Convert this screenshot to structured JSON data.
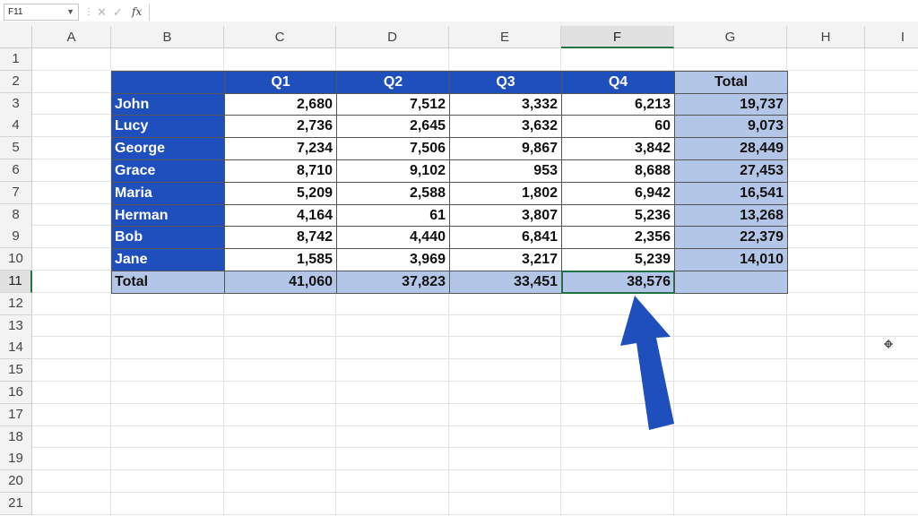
{
  "formula_bar": {
    "name_box": "F11",
    "cancel_icon": "close-icon",
    "enter_icon": "check-icon",
    "function_label": "fx",
    "formula": ""
  },
  "columns": [
    "A",
    "B",
    "C",
    "D",
    "E",
    "F",
    "G",
    "H",
    "I"
  ],
  "rows": [
    "1",
    "2",
    "3",
    "4",
    "5",
    "6",
    "7",
    "8",
    "9",
    "10",
    "11",
    "12",
    "13",
    "14",
    "15",
    "16",
    "17",
    "18",
    "19",
    "20",
    "21"
  ],
  "selected_cell": {
    "column": "F",
    "row": "11"
  },
  "table": {
    "headers": [
      "",
      "Q1",
      "Q2",
      "Q3",
      "Q4",
      "Total"
    ],
    "rows": [
      {
        "name": "John",
        "values": [
          "2,680",
          "7,512",
          "3,332",
          "6,213"
        ],
        "total": "19,737"
      },
      {
        "name": "Lucy",
        "values": [
          "2,736",
          "2,645",
          "3,632",
          "60"
        ],
        "total": "9,073"
      },
      {
        "name": "George",
        "values": [
          "7,234",
          "7,506",
          "9,867",
          "3,842"
        ],
        "total": "28,449"
      },
      {
        "name": "Grace",
        "values": [
          "8,710",
          "9,102",
          "953",
          "8,688"
        ],
        "total": "27,453"
      },
      {
        "name": "Maria",
        "values": [
          "5,209",
          "2,588",
          "1,802",
          "6,942"
        ],
        "total": "16,541"
      },
      {
        "name": "Herman",
        "values": [
          "4,164",
          "61",
          "3,807",
          "5,236"
        ],
        "total": "13,268"
      },
      {
        "name": "Bob",
        "values": [
          "8,742",
          "4,440",
          "6,841",
          "2,356"
        ],
        "total": "22,379"
      },
      {
        "name": "Jane",
        "values": [
          "1,585",
          "3,969",
          "3,217",
          "5,239"
        ],
        "total": "14,010"
      }
    ],
    "total_row": {
      "label": "Total",
      "values": [
        "41,060",
        "37,823",
        "33,451",
        "38,576"
      ],
      "total": ""
    }
  },
  "colors": {
    "header_blue": "#1f4fbd",
    "total_fill": "#b4c6e7",
    "arrow_blue": "#1f4fbd",
    "selection_green": "#217346"
  },
  "annotation": {
    "icon": "arrow-up-icon"
  }
}
